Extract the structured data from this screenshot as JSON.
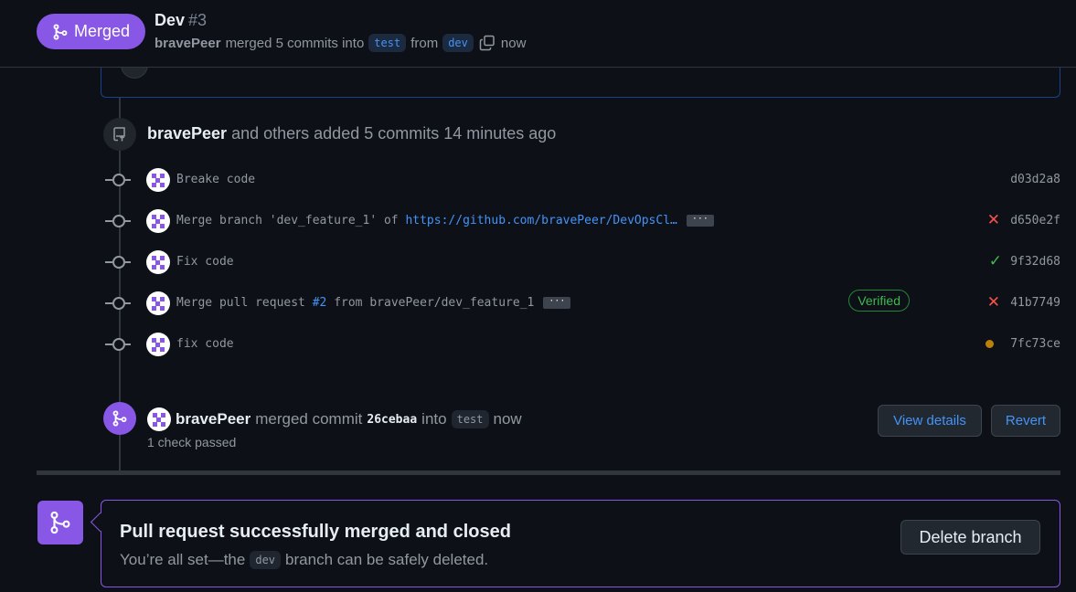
{
  "header": {
    "state_label": "Merged",
    "title": "Dev",
    "number": "#3",
    "author": "bravePeer",
    "merge_text": "merged 5 commits into",
    "base_branch": "test",
    "from_text": "from",
    "head_branch": "dev",
    "time": "now"
  },
  "timeline": {
    "added": {
      "author": "bravePeer",
      "text": "and others added 5 commits 14 minutes ago"
    },
    "commits": [
      {
        "message": "Breake code",
        "link": "",
        "ellipsis": false,
        "sha": "d03d2a8",
        "status": "none",
        "status_glyph": "",
        "verified": ""
      },
      {
        "message": "Merge branch 'dev_feature_1' of ",
        "link": "https://github.com/bravePeer/DevOpsCl…",
        "ellipsis": true,
        "sha": "d650e2f",
        "status": "fail",
        "status_glyph": "✕",
        "verified": ""
      },
      {
        "message": "Fix code",
        "link": "",
        "ellipsis": false,
        "sha": "9f32d68",
        "status": "ok",
        "status_glyph": "✓",
        "verified": ""
      },
      {
        "message_pre": "Merge pull request ",
        "pr_link": "#2",
        "message_post": " from bravePeer/dev_feature_1",
        "ellipsis": true,
        "sha": "41b7749",
        "status": "fail",
        "status_glyph": "✕",
        "verified": "Verified"
      },
      {
        "message": "fix code",
        "link": "",
        "ellipsis": false,
        "sha": "7fc73ce",
        "status": "pending",
        "status_glyph": "",
        "verified": ""
      }
    ],
    "ellipsis_label": "···",
    "merge_event": {
      "author": "bravePeer",
      "text": "merged commit",
      "sha": "26cebaa",
      "into": "into",
      "branch": "test",
      "time": "now",
      "checks": "1 check passed",
      "view_details": "View details",
      "revert": "Revert"
    }
  },
  "merge_box": {
    "title": "Pull request successfully merged and closed",
    "sub_pre": "You’re all set—the",
    "branch": "dev",
    "sub_post": "branch can be safely deleted.",
    "delete_label": "Delete branch"
  },
  "colors": {
    "merged": "#8957e5",
    "link": "#4493f8",
    "fail": "#f85149",
    "success": "#3fb950",
    "pending": "#bb8009"
  }
}
